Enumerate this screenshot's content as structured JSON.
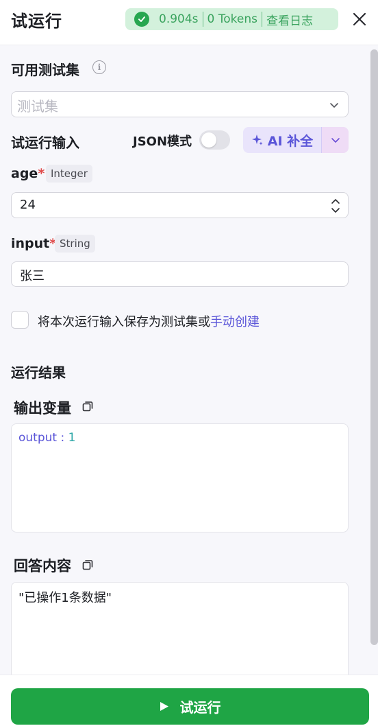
{
  "header": {
    "title": "试运行",
    "status": {
      "time": "0.904s",
      "tokens": "0 Tokens",
      "log_link": "查看日志"
    }
  },
  "test_set": {
    "label": "可用测试集",
    "placeholder": "测试集"
  },
  "input_section": {
    "label": "试运行输入",
    "json_mode_label": "JSON模式",
    "json_mode_on": false,
    "ai_button_label": "AI 补全"
  },
  "fields": [
    {
      "name": "age",
      "required_mark": "*",
      "type": "Integer",
      "value": "24"
    },
    {
      "name": "input",
      "required_mark": "*",
      "type": "String",
      "value": "张三"
    }
  ],
  "save_option": {
    "text": "将本次运行输入保存为测试集或",
    "link": "手动创建",
    "checked": false
  },
  "results": {
    "title": "运行结果",
    "output_variables": {
      "label": "输出变量",
      "key": "output",
      "separator": " : ",
      "value": "1"
    },
    "answer": {
      "label": "回答内容",
      "content": "\"已操作1条数据\""
    }
  },
  "footer": {
    "run_button": "试运行"
  },
  "colors": {
    "accent": "#5a55d8",
    "success": "#1fa545",
    "success_bg": "#d3f1dc"
  }
}
